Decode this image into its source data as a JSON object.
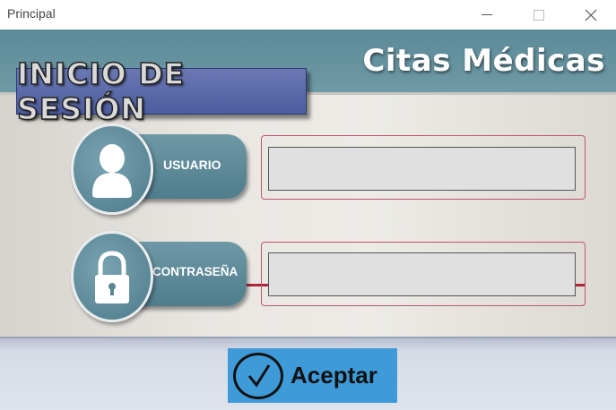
{
  "window": {
    "title": "Principal"
  },
  "header": {
    "brand": "Citas Médicas"
  },
  "login": {
    "heading": "INICIO DE SESIÓN",
    "user_label": "USUARIO",
    "password_label": "CONTRASEÑA",
    "user_value": "",
    "password_value": ""
  },
  "footer": {
    "accept_label": "Aceptar"
  },
  "colors": {
    "header": "#5b8a98",
    "badge": "#5a69a9",
    "pill": "#5f8b99",
    "accept_button": "#3f9bd8",
    "input_frame": "#c0546a",
    "accent_line": "#b2233f"
  },
  "icons": {
    "user": "user-icon",
    "lock": "lock-icon",
    "check": "check-icon"
  }
}
